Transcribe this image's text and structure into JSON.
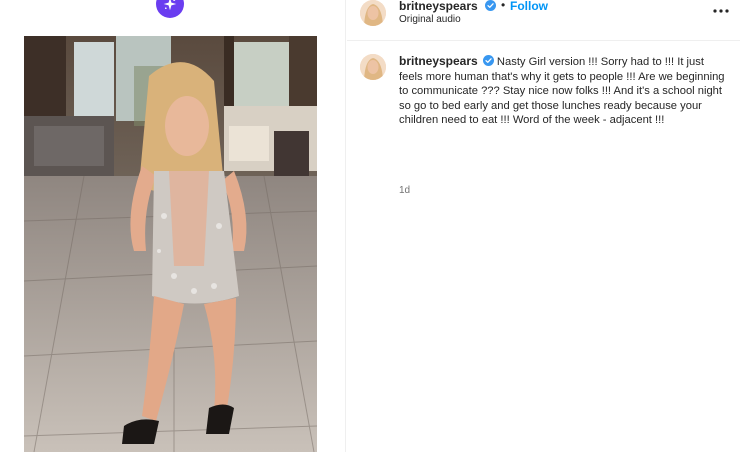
{
  "post": {
    "username": "britneyspears",
    "follow_label": "Follow",
    "separator": "•",
    "audio_label": "Original audio",
    "caption": "Nasty Girl version !!! Sorry had to !!! It just feels more human that's why it gets to people !!! Are we beginning to communicate ??? Stay nice now folks !!! And it's a school night so go to bed early and get those lunches ready because your children need to eat !!! Word of the week - adjacent !!!",
    "time_ago": "1d"
  },
  "icons": {
    "reel_badge": "sparkle-icon",
    "verified": "verified-badge-icon",
    "more": "more-options-icon"
  },
  "colors": {
    "accent": "#0095f6",
    "verified": "#3897f0",
    "reel_badge": "#6a3df0",
    "muted": "#737373"
  }
}
